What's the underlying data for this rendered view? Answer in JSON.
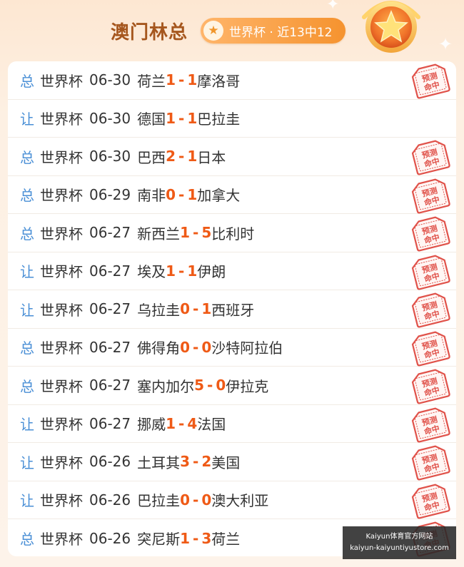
{
  "header": {
    "title": "澳门林总",
    "badge_text": "世界杯 · 近13中12",
    "star_icon": "star-icon",
    "medal_icon": "gold-medal-star-icon"
  },
  "stamp_text": "预测命中",
  "colors": {
    "accent": "#ef5a16",
    "tag": "#4a8fd6",
    "title": "#a5561d",
    "stamp": "#e0524a"
  },
  "matches": [
    {
      "tag": "总",
      "league": "世界杯",
      "date": "06-30",
      "home": "荷兰",
      "home_score": "1",
      "away_score": "1",
      "away": "摩洛哥",
      "hit": true
    },
    {
      "tag": "让",
      "league": "世界杯",
      "date": "06-30",
      "home": "德国",
      "home_score": "1",
      "away_score": "1",
      "away": "巴拉圭",
      "hit": false
    },
    {
      "tag": "总",
      "league": "世界杯",
      "date": "06-30",
      "home": "巴西",
      "home_score": "2",
      "away_score": "1",
      "away": "日本",
      "hit": true
    },
    {
      "tag": "总",
      "league": "世界杯",
      "date": "06-29",
      "home": "南非",
      "home_score": "0",
      "away_score": "1",
      "away": "加拿大",
      "hit": true
    },
    {
      "tag": "总",
      "league": "世界杯",
      "date": "06-27",
      "home": "新西兰",
      "home_score": "1",
      "away_score": "5",
      "away": "比利时",
      "hit": true
    },
    {
      "tag": "让",
      "league": "世界杯",
      "date": "06-27",
      "home": "埃及",
      "home_score": "1",
      "away_score": "1",
      "away": "伊朗",
      "hit": true
    },
    {
      "tag": "让",
      "league": "世界杯",
      "date": "06-27",
      "home": "乌拉圭",
      "home_score": "0",
      "away_score": "1",
      "away": "西班牙",
      "hit": true
    },
    {
      "tag": "总",
      "league": "世界杯",
      "date": "06-27",
      "home": "佛得角",
      "home_score": "0",
      "away_score": "0",
      "away": "沙特阿拉伯",
      "hit": true
    },
    {
      "tag": "总",
      "league": "世界杯",
      "date": "06-27",
      "home": "塞内加尔",
      "home_score": "5",
      "away_score": "0",
      "away": "伊拉克",
      "hit": true
    },
    {
      "tag": "让",
      "league": "世界杯",
      "date": "06-27",
      "home": "挪威",
      "home_score": "1",
      "away_score": "4",
      "away": "法国",
      "hit": true
    },
    {
      "tag": "让",
      "league": "世界杯",
      "date": "06-26",
      "home": "土耳其",
      "home_score": "3",
      "away_score": "2",
      "away": "美国",
      "hit": true
    },
    {
      "tag": "让",
      "league": "世界杯",
      "date": "06-26",
      "home": "巴拉圭",
      "home_score": "0",
      "away_score": "0",
      "away": "澳大利亚",
      "hit": true
    },
    {
      "tag": "总",
      "league": "世界杯",
      "date": "06-26",
      "home": "突尼斯",
      "home_score": "1",
      "away_score": "3",
      "away": "荷兰",
      "hit": true
    }
  ],
  "watermark": {
    "line1": "Kaiyun体育官方网站",
    "line2": "kaiyun-kaiyuntiyustore.com"
  }
}
